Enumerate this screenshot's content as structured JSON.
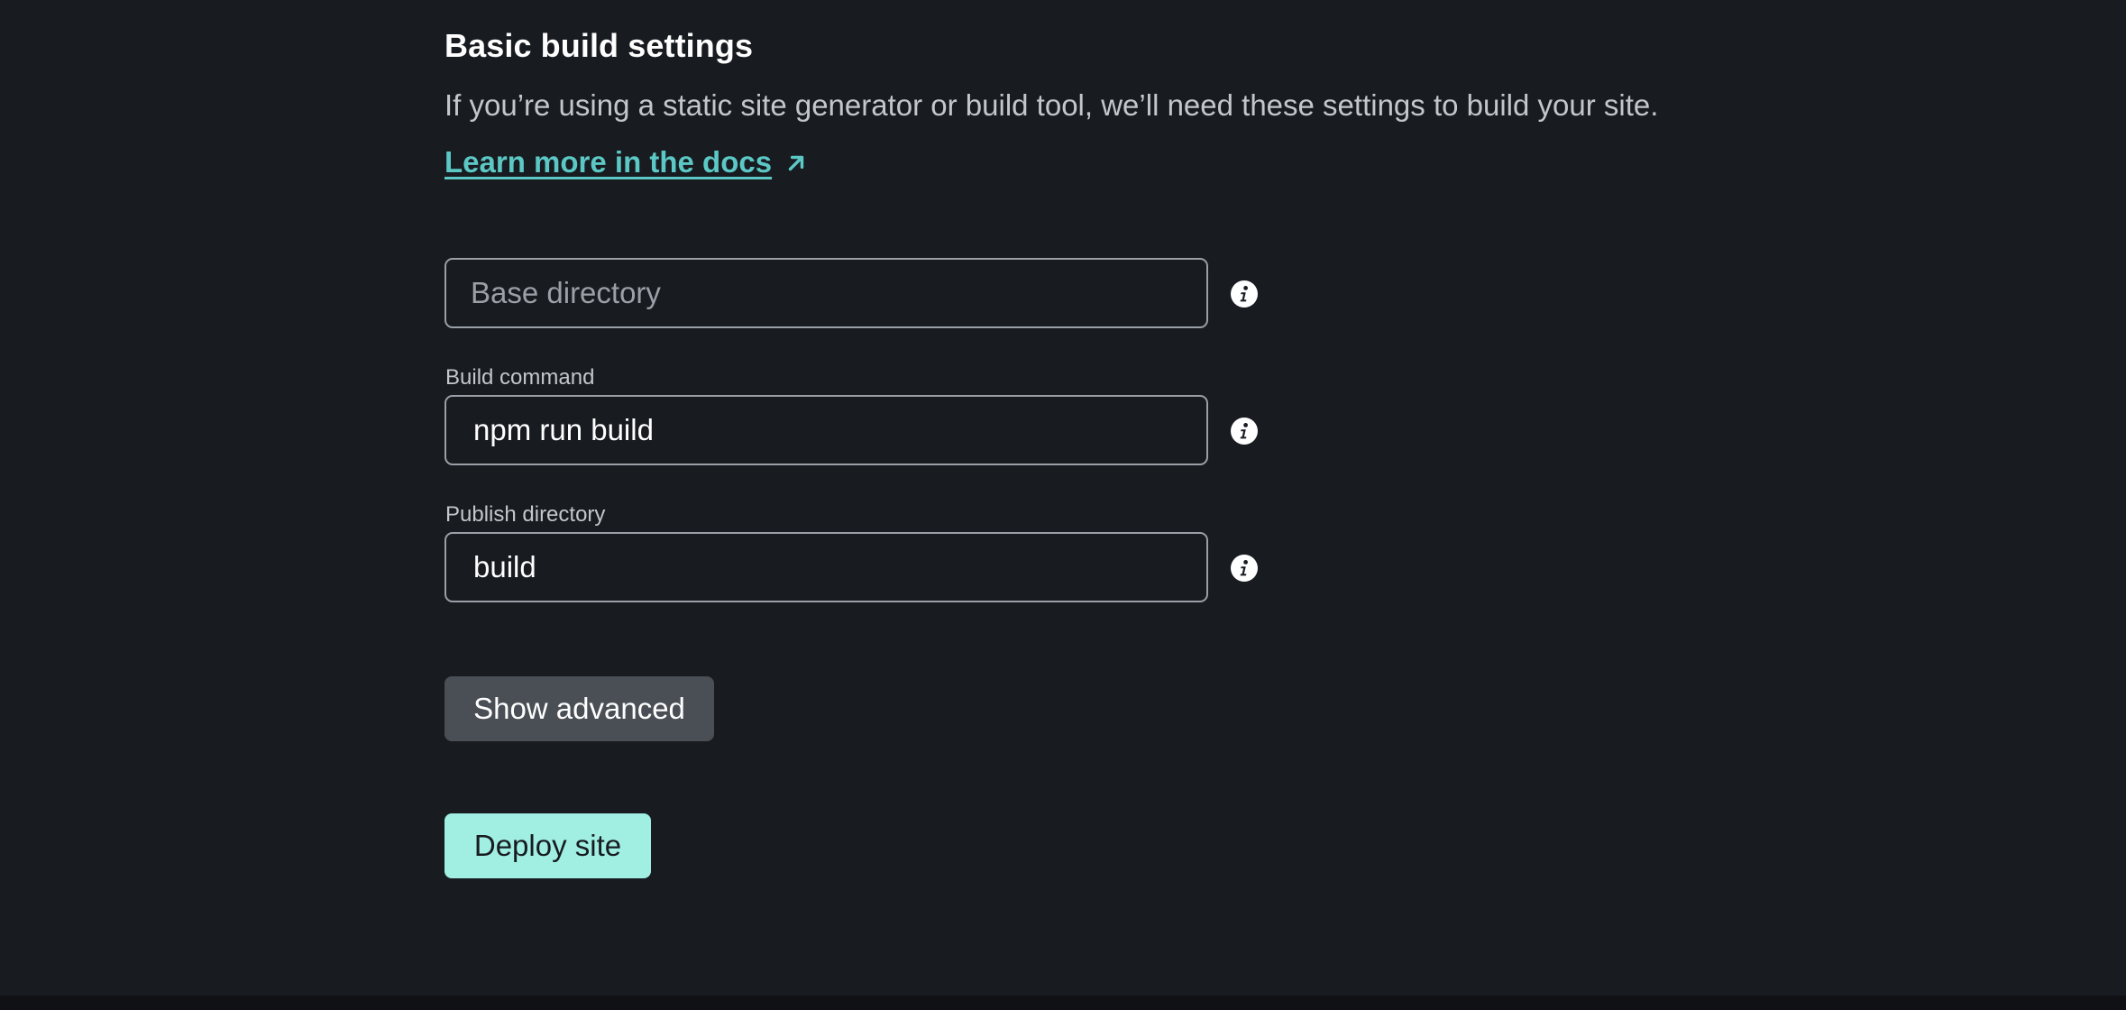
{
  "section": {
    "title": "Basic build settings",
    "description": "If you’re using a static site generator or build tool, we’ll need these settings to build your site.",
    "docs_link": "Learn more in the docs"
  },
  "fields": {
    "base_directory": {
      "label": "",
      "placeholder": "Base directory",
      "value": ""
    },
    "build_command": {
      "label": "Build command",
      "value": "npm run build"
    },
    "publish_directory": {
      "label": "Publish directory",
      "value": "build"
    }
  },
  "buttons": {
    "show_advanced": "Show advanced",
    "deploy_site": "Deploy site"
  },
  "icons": {
    "info": "info-icon",
    "external_link": "arrow-up-right-icon"
  },
  "colors": {
    "background": "#181b20",
    "link": "#5cc8c5",
    "primary_button": "#a1efe3",
    "secondary_button": "#4a4f55",
    "field_border": "#9aa0a7"
  }
}
